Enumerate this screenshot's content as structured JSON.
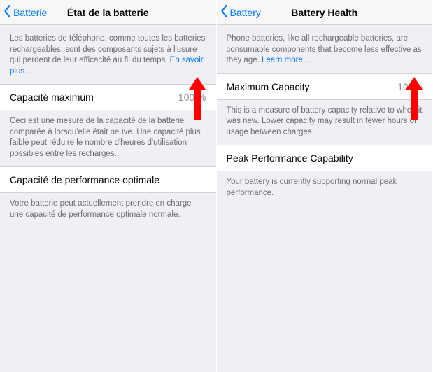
{
  "left": {
    "back_label": "Batterie",
    "title": "État de la batterie",
    "intro_text": "Les batteries de téléphone, comme toutes les batteries rechargeables, sont des composants sujets à l'usure qui perdent de leur efficacité au fil du temps. ",
    "intro_link": "En savoir plus…",
    "max_capacity_label": "Capacité maximum",
    "max_capacity_value": "100 %",
    "max_capacity_desc": "Ceci est une mesure de la capacité de la batterie comparée à lorsqu'elle était neuve. Une capacité plus faible peut réduire le nombre d'heures d'utilisation possibles entre les recharges.",
    "peak_label": "Capacité de performance optimale",
    "peak_desc": "Votre batterie peut actuellement prendre en charge une capacité de performance optimale normale."
  },
  "right": {
    "back_label": "Battery",
    "title": "Battery Health",
    "intro_text": "Phone batteries, like all rechargeable batteries, are consumable components that become less effective as they age. ",
    "intro_link": "Learn more…",
    "max_capacity_label": "Maximum Capacity",
    "max_capacity_value": "100%",
    "max_capacity_desc": "This is a measure of battery capacity relative to when it was new. Lower capacity may result in fewer hours of usage between charges.",
    "peak_label": "Peak Performance Capability",
    "peak_desc": "Your battery is currently supporting normal peak performance."
  },
  "annotation": {
    "arrow_color": "#ff0000"
  }
}
